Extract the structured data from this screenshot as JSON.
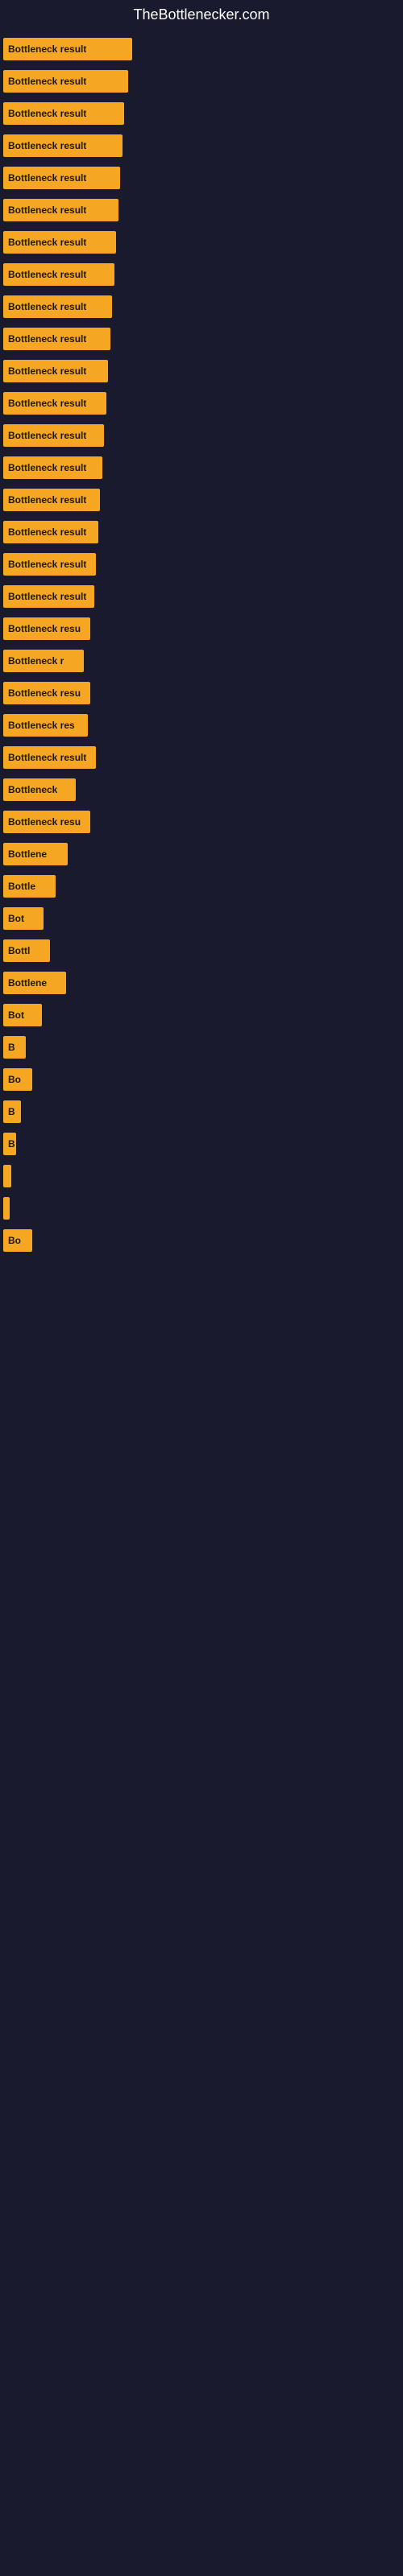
{
  "site": {
    "title": "TheBottlenecker.com"
  },
  "bars": [
    {
      "label": "Bottleneck result",
      "width": 160,
      "visible_label": "Bottleneck result"
    },
    {
      "label": "Bottleneck result",
      "width": 155,
      "visible_label": "Bottleneck result"
    },
    {
      "label": "Bottleneck result",
      "width": 150,
      "visible_label": "Bottleneck result"
    },
    {
      "label": "Bottleneck result",
      "width": 148,
      "visible_label": "Bottleneck result"
    },
    {
      "label": "Bottleneck result",
      "width": 145,
      "visible_label": "Bottleneck result"
    },
    {
      "label": "Bottleneck result",
      "width": 143,
      "visible_label": "Bottleneck result"
    },
    {
      "label": "Bottleneck result",
      "width": 140,
      "visible_label": "Bottleneck result"
    },
    {
      "label": "Bottleneck result",
      "width": 138,
      "visible_label": "Bottleneck result"
    },
    {
      "label": "Bottleneck result",
      "width": 135,
      "visible_label": "Bottleneck result"
    },
    {
      "label": "Bottleneck result",
      "width": 133,
      "visible_label": "Bottleneck result"
    },
    {
      "label": "Bottleneck result",
      "width": 130,
      "visible_label": "Bottleneck result"
    },
    {
      "label": "Bottleneck result",
      "width": 128,
      "visible_label": "Bottleneck result"
    },
    {
      "label": "Bottleneck result",
      "width": 125,
      "visible_label": "Bottleneck result"
    },
    {
      "label": "Bottleneck result",
      "width": 123,
      "visible_label": "Bottleneck result"
    },
    {
      "label": "Bottleneck result",
      "width": 120,
      "visible_label": "Bottleneck result"
    },
    {
      "label": "Bottleneck result",
      "width": 118,
      "visible_label": "Bottleneck result"
    },
    {
      "label": "Bottleneck result",
      "width": 115,
      "visible_label": "Bottleneck result"
    },
    {
      "label": "Bottleneck result",
      "width": 113,
      "visible_label": "Bottleneck result"
    },
    {
      "label": "Bottleneck resu",
      "width": 108,
      "visible_label": "Bottleneck resu"
    },
    {
      "label": "Bottleneck r",
      "width": 100,
      "visible_label": "Bottleneck r"
    },
    {
      "label": "Bottleneck resu",
      "width": 108,
      "visible_label": "Bottleneck resu"
    },
    {
      "label": "Bottleneck res",
      "width": 105,
      "visible_label": "Bottleneck res"
    },
    {
      "label": "Bottleneck result",
      "width": 115,
      "visible_label": "Bottleneck result"
    },
    {
      "label": "Bottleneck",
      "width": 90,
      "visible_label": "Bottleneck"
    },
    {
      "label": "Bottleneck resu",
      "width": 108,
      "visible_label": "Bottleneck resu"
    },
    {
      "label": "Bottlene",
      "width": 80,
      "visible_label": "Bottlene"
    },
    {
      "label": "Bottle",
      "width": 65,
      "visible_label": "Bottle"
    },
    {
      "label": "Bot",
      "width": 50,
      "visible_label": "Bot"
    },
    {
      "label": "Bottl",
      "width": 58,
      "visible_label": "Bottl"
    },
    {
      "label": "Bottlene",
      "width": 78,
      "visible_label": "Bottlene"
    },
    {
      "label": "Bot",
      "width": 48,
      "visible_label": "Bot"
    },
    {
      "label": "B",
      "width": 28,
      "visible_label": "B"
    },
    {
      "label": "Bo",
      "width": 36,
      "visible_label": "Bo"
    },
    {
      "label": "B",
      "width": 22,
      "visible_label": "B"
    },
    {
      "label": "B",
      "width": 16,
      "visible_label": "B"
    },
    {
      "label": "",
      "width": 10,
      "visible_label": ""
    },
    {
      "label": "",
      "width": 8,
      "visible_label": ""
    },
    {
      "label": "Bo",
      "width": 36,
      "visible_label": "Bo"
    }
  ]
}
